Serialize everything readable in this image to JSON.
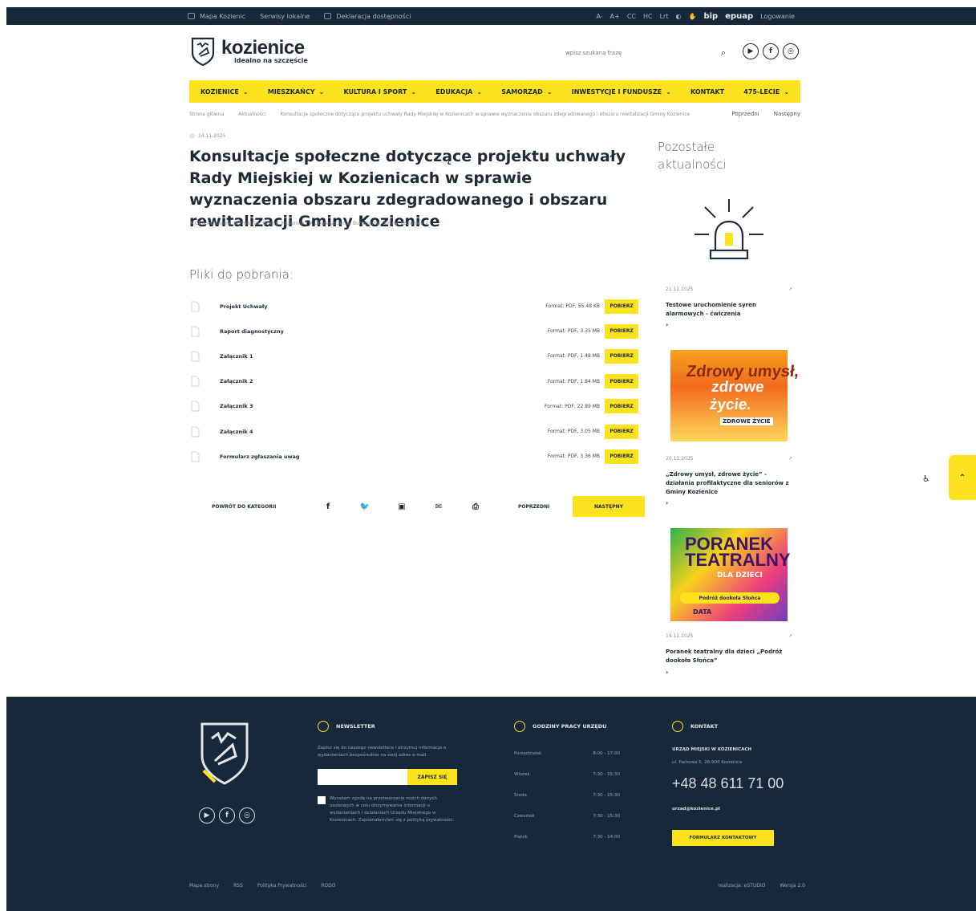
{
  "topbar": {
    "links": [
      "Mapa Kozienic",
      "Serwisy lokalne",
      "Deklaracja dostępności"
    ],
    "font_controls": [
      "A-",
      "A+",
      "CC",
      "HC",
      "Lrt"
    ],
    "bip": "bip",
    "epuap": "epuap",
    "login": "Logowanie"
  },
  "header": {
    "logo_name": "kozienice",
    "logo_tagline": "idealno na szczęście",
    "search_placeholder": "wpisz szukaną frazę",
    "socials": [
      "youtube-icon",
      "facebook-icon",
      "instagram-icon"
    ]
  },
  "nav": {
    "items": [
      {
        "label": "KOZIENICE",
        "chevron": true
      },
      {
        "label": "MIESZKAŃCY",
        "chevron": true
      },
      {
        "label": "KULTURA I SPORT",
        "chevron": true
      },
      {
        "label": "EDUKACJA",
        "chevron": true
      },
      {
        "label": "SAMORZĄD",
        "chevron": true
      },
      {
        "label": "INWESTYCJE I FUNDUSZE",
        "chevron": true
      },
      {
        "label": "KONTAKT",
        "chevron": false
      },
      {
        "label": "475-LECIE",
        "chevron": true
      }
    ]
  },
  "breadcrumb": {
    "home": "Strona główna",
    "section": "Aktualności",
    "current": "Konsultacje społeczne dotyczące projektu uchwały Rady Miejskiej w Kozienicach w sprawie wyznaczenia obszaru zdegradowanego i obszaru rewitalizacji Gminy Kozienice",
    "prev": "Poprzedni",
    "next": "Następny"
  },
  "article": {
    "date": "24.11.2025",
    "title": "Konsultacje społeczne dotyczące projektu uchwały Rady Miejskiej w Kozienicach w sprawie wyznaczenia obszaru zdegradowanego i obszaru rewitalizacji Gminy Kozienice",
    "tags": "# Obwieszczenie, Burmistrza, Gminy, Kozienice | # Obwieszczenie, Burmistrza, Gminy, Kozienice 2",
    "files_heading": "Pliki do pobrania:",
    "download_label": "POBIERZ",
    "files": [
      {
        "name": "Projekt Uchwały",
        "meta": "Format: PDF, 55.48 KB"
      },
      {
        "name": "Raport diagnostyczny",
        "meta": "Format: PDF, 3.35 MB"
      },
      {
        "name": "Załącznik 1",
        "meta": "Format: PDF, 1.48 MB"
      },
      {
        "name": "Załącznik 2",
        "meta": "Format: PDF, 1.84 MB"
      },
      {
        "name": "Załącznik 3",
        "meta": "Format: PDF, 22.89 MB"
      },
      {
        "name": "Załącznik 4",
        "meta": "Format: PDF, 3.05 MB"
      },
      {
        "name": "Formularz zgłaszania uwag",
        "meta": "Format: PDF, 3.36 MB"
      }
    ],
    "back_label": "POWRÓT DO KATEGORII",
    "prev_label": "POPRZEDNI",
    "next_label": "NASTĘPNY"
  },
  "sidebar": {
    "heading": "Pozostałe aktualności",
    "cards": [
      {
        "date": "21.11.2025",
        "title": "Testowe uruchomienie syren alarmowych - ćwiczenia"
      },
      {
        "date": "20.11.2025",
        "title": "„Zdrowy umysł, zdrowe życie” - działania profilaktyczne dla seniorów z Gminy Kozienice"
      },
      {
        "date": "19.11.2025",
        "title": "Poranek teatralny dla dzieci „Podróż dookoła Słońca”"
      }
    ],
    "poster1": {
      "line1": "Zdrowy umysł,",
      "line2": "zdrowe życie.",
      "line3": "ZDROWE ŻYCIE"
    },
    "poster2": {
      "line1": "PORANEK TEATRALNY",
      "line2": "DLA DZIECI",
      "line3": "Podróż dookoła Słońca",
      "line4": "DATA"
    }
  },
  "footer": {
    "newsletter": {
      "heading": "NEWSLETTER",
      "text": "Zapisz się do naszego newslettera i otrzymuj informacje o wydarzeniach bezpośrednio na swój adres e-mail.",
      "button": "ZAPISZ SIĘ",
      "consent": "Wyrażam zgodę na przetwarzanie moich danych osobowych w celu otrzymywania informacji o wydarzeniach i działaniach Urzędu Miejskiego w Kozienicach. Zapoznałem/am się z polityką prywatności."
    },
    "hours": {
      "heading": "GODZINY PRACY URZĘDU",
      "rows": [
        {
          "day": "Poniedziałek",
          "time": "8:00 - 17:00"
        },
        {
          "day": "Wtorek",
          "time": "7:30 - 15:30"
        },
        {
          "day": "Środa",
          "time": "7:30 - 15:30"
        },
        {
          "day": "Czwartek",
          "time": "7:30 - 15:30"
        },
        {
          "day": "Piątek",
          "time": "7:30 - 14:00"
        }
      ]
    },
    "contact": {
      "heading": "KONTAKT",
      "office": "URZĄD MIEJSKI W KOZIENICACH",
      "address": "ul. Parkowa 5, 26-900 Kozienice",
      "phone": "+48 48 611 71 00",
      "email": "urzad@kozienice.pl",
      "button": "FORMULARZ KONTAKTOWY"
    },
    "bottom": {
      "links": [
        "Mapa strony",
        "RSS",
        "Polityka Prywatności",
        "RODO"
      ],
      "right": [
        "realizacja: eSTUDIO",
        "Wersja 2.0"
      ]
    }
  }
}
